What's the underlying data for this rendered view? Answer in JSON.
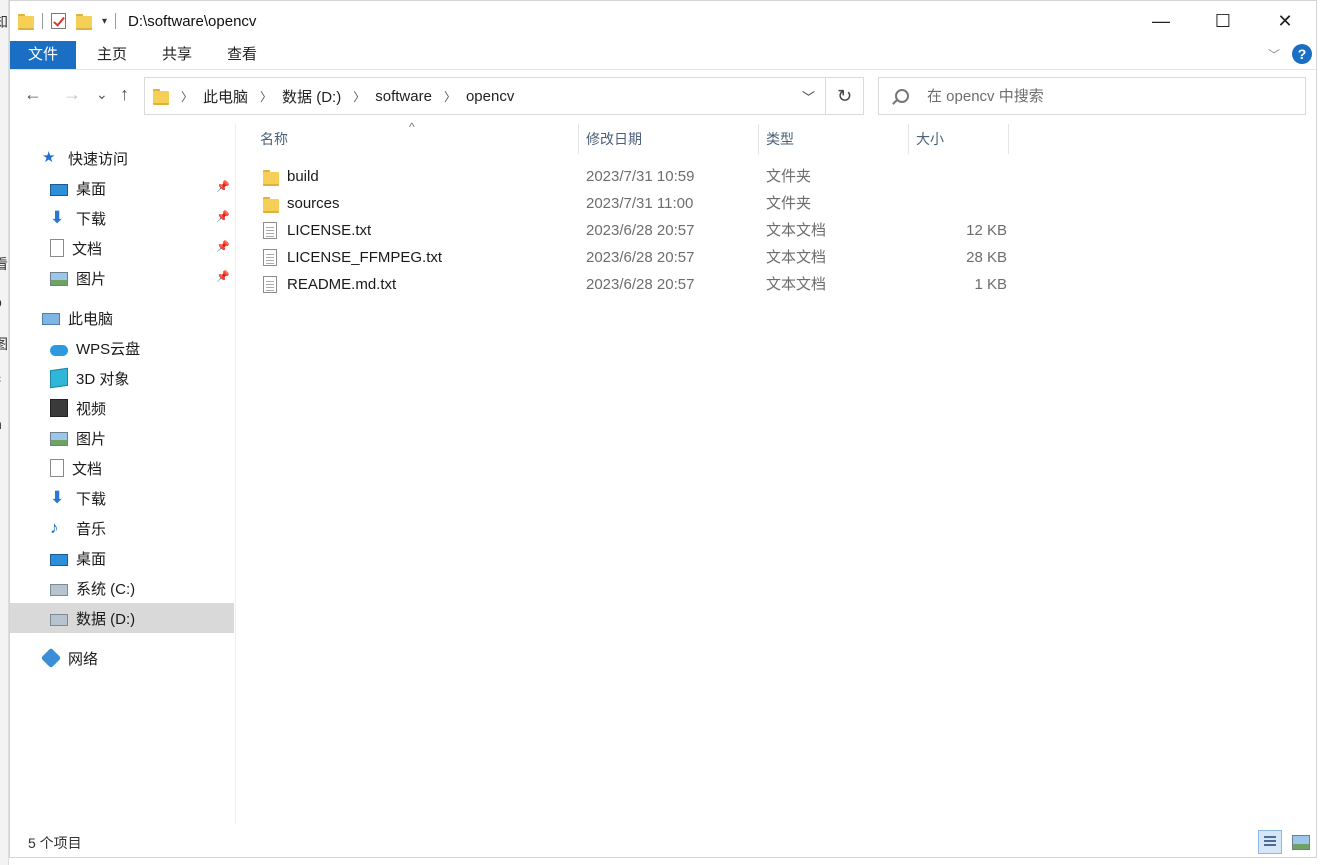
{
  "window": {
    "title": "D:\\software\\opencv",
    "controls": {
      "minimize": "—",
      "maximize": "☐",
      "close": "✕"
    }
  },
  "background_window": {
    "fragments": [
      "知",
      "看",
      "o",
      "图",
      "c",
      "n"
    ]
  },
  "ribbon": {
    "tabs": [
      "文件",
      "主页",
      "共享",
      "查看"
    ],
    "help": "?"
  },
  "nav": {
    "back": "←",
    "forward": "→",
    "recent": "⌄",
    "up": "↑",
    "breadcrumb": [
      "此电脑",
      "数据 (D:)",
      "software",
      "opencv"
    ],
    "refresh": "↻",
    "search_placeholder": "在 opencv 中搜索"
  },
  "sidebar": {
    "quick_access": "快速访问",
    "quick_items": [
      "桌面",
      "下载",
      "文档",
      "图片"
    ],
    "this_pc": "此电脑",
    "pc_items": [
      "WPS云盘",
      "3D 对象",
      "视频",
      "图片",
      "文档",
      "下载",
      "音乐",
      "桌面",
      "系统 (C:)",
      "数据 (D:)"
    ],
    "network": "网络",
    "selected": "数据 (D:)"
  },
  "filelist": {
    "columns": [
      "名称",
      "修改日期",
      "类型",
      "大小"
    ],
    "sort_indicator": "^",
    "rows": [
      {
        "name": "build",
        "date": "2023/7/31 10:59",
        "type": "文件夹",
        "size": "",
        "icon": "folder-icon"
      },
      {
        "name": "sources",
        "date": "2023/7/31 11:00",
        "type": "文件夹",
        "size": "",
        "icon": "folder-icon"
      },
      {
        "name": "LICENSE.txt",
        "date": "2023/6/28 20:57",
        "type": "文本文档",
        "size": "12 KB",
        "icon": "text-file-icon"
      },
      {
        "name": "LICENSE_FFMPEG.txt",
        "date": "2023/6/28 20:57",
        "type": "文本文档",
        "size": "28 KB",
        "icon": "text-file-icon"
      },
      {
        "name": "README.md.txt",
        "date": "2023/6/28 20:57",
        "type": "文本文档",
        "size": "1 KB",
        "icon": "text-file-icon"
      }
    ]
  },
  "status": {
    "count": "5 个项目"
  },
  "colors": {
    "accent": "#1a6fc4",
    "selected_bg": "#d9d9d9",
    "header_text": "#4c607a"
  }
}
